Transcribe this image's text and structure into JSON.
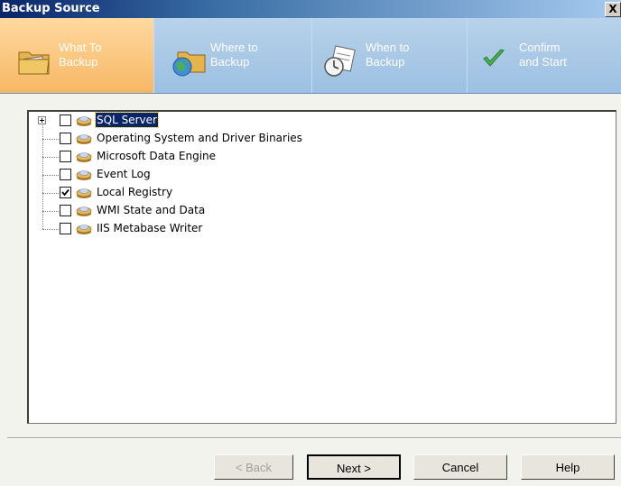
{
  "window": {
    "title": "Backup Source",
    "close_label": "X"
  },
  "steps": [
    {
      "label": "What To\nBackup",
      "active": true,
      "icon": "folder-picture-icon"
    },
    {
      "label": "Where to\nBackup",
      "active": false,
      "icon": "globe-folder-icon"
    },
    {
      "label": "When to\nBackup",
      "active": false,
      "icon": "calendar-clock-icon"
    },
    {
      "label": "Confirm\nand Start",
      "active": false,
      "icon": "checkmark-icon"
    }
  ],
  "tree": {
    "items": [
      {
        "label": "SQL Server",
        "checked": false,
        "expandable": true,
        "selected": true
      },
      {
        "label": "Operating System and Driver Binaries",
        "checked": false,
        "expandable": false,
        "selected": false
      },
      {
        "label": "Microsoft Data Engine",
        "checked": false,
        "expandable": false,
        "selected": false
      },
      {
        "label": "Event Log",
        "checked": false,
        "expandable": false,
        "selected": false
      },
      {
        "label": "Local Registry",
        "checked": true,
        "expandable": false,
        "selected": false
      },
      {
        "label": "WMI State and Data",
        "checked": false,
        "expandable": false,
        "selected": false
      },
      {
        "label": "IIS Metabase Writer",
        "checked": false,
        "expandable": false,
        "selected": false
      }
    ]
  },
  "buttons": {
    "back": "< Back",
    "next": "Next >",
    "cancel": "Cancel",
    "help": "Help"
  }
}
